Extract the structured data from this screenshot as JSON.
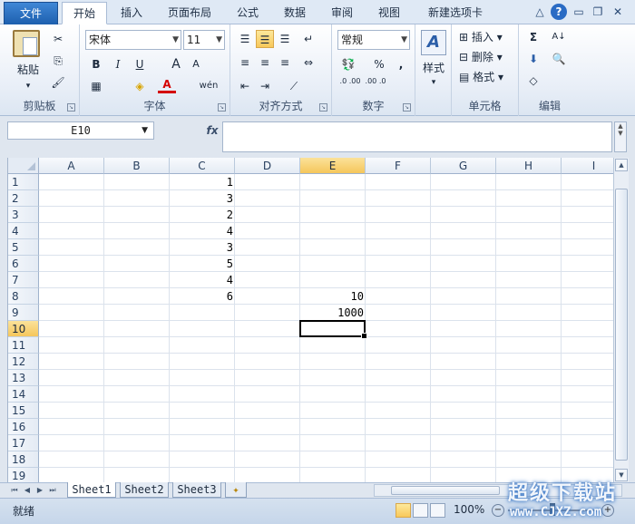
{
  "tabs": {
    "file": "文件",
    "items": [
      {
        "label": "开始",
        "active": true
      },
      {
        "label": "插入"
      },
      {
        "label": "页面布局"
      },
      {
        "label": "公式"
      },
      {
        "label": "数据"
      },
      {
        "label": "审阅"
      },
      {
        "label": "视图"
      },
      {
        "label": "新建选项卡"
      }
    ]
  },
  "window_controls": {
    "collapse": "△",
    "help": "?",
    "minimize": "▭",
    "restore": "❐",
    "close": "✕"
  },
  "ribbon": {
    "clipboard": {
      "label": "剪贴板",
      "paste": "粘贴",
      "cut": "✂",
      "copy": "⎘",
      "format_painter": "🖌"
    },
    "font": {
      "label": "字体",
      "font_name": "宋体",
      "font_size": "11",
      "bold": "B",
      "italic": "I",
      "underline": "U",
      "grow": "A",
      "shrink": "A",
      "border": "▦",
      "fill": "◈",
      "font_color": "A",
      "phonetic": "wén"
    },
    "alignment": {
      "label": "对齐方式",
      "merge": "⇔",
      "wrap": "↵",
      "orient": "⟋"
    },
    "number": {
      "label": "数字",
      "format": "常规",
      "currency": "💱",
      "percent": "%",
      "comma": ",",
      "inc_decimal": ".0 .00",
      "dec_decimal": ".00 .0"
    },
    "styles": {
      "label": "样式",
      "button": "样式",
      "icon": "A"
    },
    "cells": {
      "label": "单元格",
      "insert": "插入",
      "delete": "删除",
      "format": "格式"
    },
    "editing": {
      "label": "编辑",
      "sum": "Σ",
      "sort": "A↓",
      "fill": "⬇",
      "find": "🔍",
      "clear": "◇"
    }
  },
  "formula_bar": {
    "name_box": "E10",
    "fx": "fx",
    "formula": ""
  },
  "grid": {
    "columns": [
      "A",
      "B",
      "C",
      "D",
      "E",
      "F",
      "G",
      "H",
      "I"
    ],
    "active_column": "E",
    "rows": [
      "1",
      "2",
      "3",
      "4",
      "5",
      "6",
      "7",
      "8",
      "9",
      "10",
      "11",
      "12",
      "13",
      "14",
      "15",
      "16",
      "17",
      "18",
      "19"
    ],
    "active_row": "10",
    "cells": {
      "C1": "1",
      "C2": "3",
      "C3": "2",
      "C4": "4",
      "C5": "3",
      "C6": "5",
      "C7": "4",
      "C8": "6",
      "E8": "10",
      "E9": "1000"
    },
    "selected_cell": "E10"
  },
  "sheets": {
    "tabs": [
      "Sheet1",
      "Sheet2",
      "Sheet3"
    ],
    "active": "Sheet1",
    "new_sheet_icon": "✦"
  },
  "status": {
    "text": "就绪",
    "zoom": "100%",
    "zoom_minus": "−",
    "zoom_plus": "+"
  },
  "watermark": {
    "line1": "超级下载站",
    "line2": "www.CJXZ.com"
  }
}
